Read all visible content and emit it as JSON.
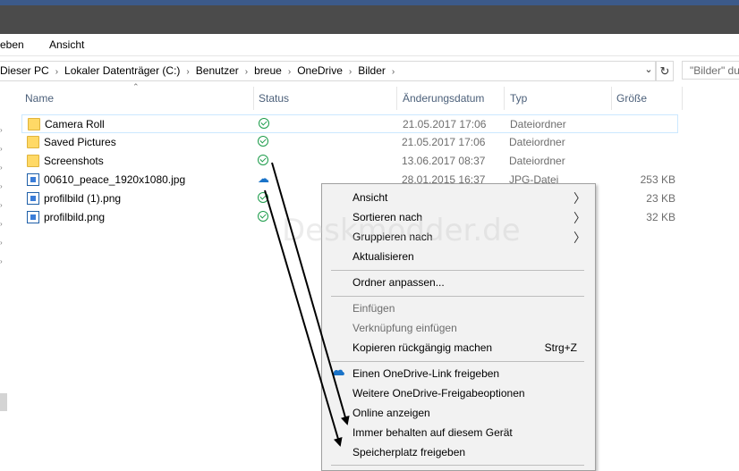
{
  "ribbon": {
    "tab1": "eben",
    "tab2": "Ansicht"
  },
  "address": {
    "crumbs": [
      "Dieser PC",
      "Lokaler Datenträger (C:)",
      "Benutzer",
      "breue",
      "OneDrive",
      "Bilder"
    ],
    "search_placeholder": "\"Bilder\" du"
  },
  "columns": {
    "name": "Name",
    "status": "Status",
    "date": "Änderungsdatum",
    "type": "Typ",
    "size": "Größe"
  },
  "files": [
    {
      "name": "Camera Roll",
      "status": "synced",
      "date": "21.05.2017 17:06",
      "type": "Dateiordner",
      "size": ""
    },
    {
      "name": "Saved Pictures",
      "status": "synced",
      "date": "21.05.2017 17:06",
      "type": "Dateiordner",
      "size": ""
    },
    {
      "name": "Screenshots",
      "status": "synced",
      "date": "13.06.2017 08:37",
      "type": "Dateiordner",
      "size": ""
    },
    {
      "name": "00610_peace_1920x1080.jpg",
      "status": "cloud",
      "date": "28.01.2015 16:37",
      "type": "JPG-Datei",
      "size": "253 KB"
    },
    {
      "name": "profilbild (1).png",
      "status": "synced",
      "date": "",
      "type": "",
      "size": "23 KB"
    },
    {
      "name": "profilbild.png",
      "status": "synced",
      "date": "",
      "type": "",
      "size": "32 KB"
    }
  ],
  "context_menu": {
    "ansicht": "Ansicht",
    "sortieren": "Sortieren nach",
    "gruppieren": "Gruppieren nach",
    "aktualisieren": "Aktualisieren",
    "ordner_anpassen": "Ordner anpassen...",
    "einfuegen": "Einfügen",
    "verknuepfung": "Verknüpfung einfügen",
    "rueckgaengig": "Kopieren rückgängig machen",
    "rueckgaengig_shortcut": "Strg+Z",
    "onedrive_link": "Einen OneDrive-Link freigeben",
    "weitere_optionen": "Weitere OneDrive-Freigabeoptionen",
    "online": "Online anzeigen",
    "immer_behalten": "Immer behalten auf diesem Gerät",
    "speicherplatz": "Speicherplatz freigeben"
  },
  "watermark": "Deskmodder.de",
  "colors": {
    "accent": "#1a73c8",
    "synced": "#1c9c4a",
    "folder": "#ffd966"
  }
}
